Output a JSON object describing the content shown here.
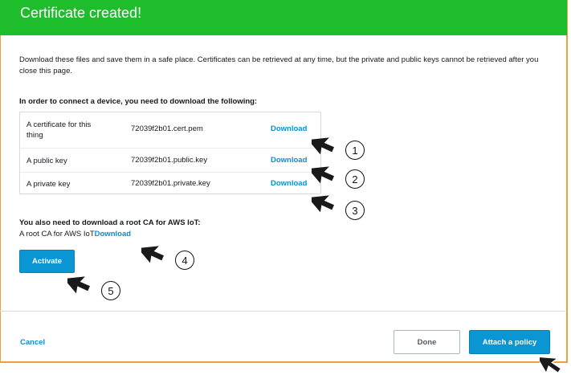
{
  "header": {
    "title": "Certificate created!"
  },
  "description": "Download these files and save them in a safe place. Certificates can be retrieved at any time, but the private and public keys cannot be retrieved after you close this page.",
  "files_heading": "In order to connect a device, you need to download the following:",
  "files": [
    {
      "desc": "A certificate for this thing",
      "file": "72039f2b01.cert.pem",
      "action": "Download"
    },
    {
      "desc": "A public key",
      "file": "72039f2b01.public.key",
      "action": "Download"
    },
    {
      "desc": "A private key",
      "file": "72039f2b01.private.key",
      "action": "Download"
    }
  ],
  "root_ca": {
    "heading": "You also need to download a root CA for AWS IoT:",
    "label": "A root CA for AWS IoT",
    "action": "Download"
  },
  "buttons": {
    "activate": "Activate",
    "cancel": "Cancel",
    "done": "Done",
    "attach": "Attach a policy"
  },
  "callouts": [
    "1",
    "2",
    "3",
    "4",
    "5"
  ],
  "colors": {
    "header": "#1dbd2b",
    "primary": "#0a95d3",
    "link": "#0a8fd0",
    "frame": "#e6a23c"
  }
}
